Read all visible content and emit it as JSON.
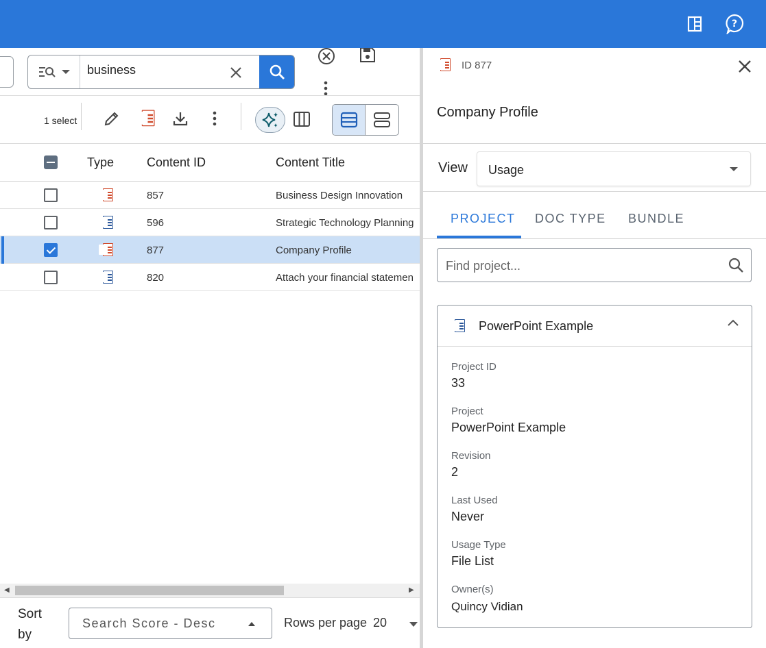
{
  "topbar": {
    "bg": "#2a77d9",
    "icons": [
      "building-icon",
      "help-icon"
    ]
  },
  "search": {
    "query": "business"
  },
  "toolbar": {
    "selected_count": "1 select"
  },
  "grid": {
    "columns": {
      "type": "Type",
      "content_id": "Content ID",
      "content_title": "Content Title"
    },
    "rows": [
      {
        "type": "ppt",
        "id": "857",
        "title": "Business Design Innovation",
        "checked": false
      },
      {
        "type": "word",
        "id": "596",
        "title": "Strategic Technology Planning",
        "checked": false
      },
      {
        "type": "ppt",
        "id": "877",
        "title": "Company Profile",
        "checked": true
      },
      {
        "type": "word",
        "id": "820",
        "title": "Attach your financial statemen",
        "checked": false
      }
    ]
  },
  "footer": {
    "sort_label": "Sort by",
    "sort_value": "Search Score - Desc",
    "rows_per_page_label": "Rows per page",
    "rows_per_page_value": "20"
  },
  "details": {
    "id_label": "ID 877",
    "title": "Company Profile",
    "view_label": "View",
    "view_value": "Usage",
    "tabs": [
      "PROJECT",
      "DOC TYPE",
      "BUNDLE"
    ],
    "find_placeholder": "Find project...",
    "card": {
      "name": "PowerPoint Example",
      "fields": [
        {
          "label": "Project ID",
          "value": "33"
        },
        {
          "label": "Project",
          "value": "PowerPoint Example"
        },
        {
          "label": "Revision",
          "value": "2"
        },
        {
          "label": "Last Used",
          "value": "Never"
        },
        {
          "label": "Usage Type",
          "value": "File List"
        },
        {
          "label": "Owner(s)",
          "value": "Quincy Vidian"
        }
      ]
    }
  }
}
